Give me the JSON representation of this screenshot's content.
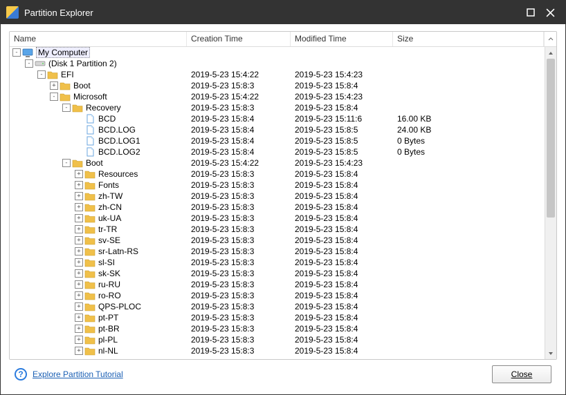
{
  "window": {
    "title": "Partition Explorer"
  },
  "columns": {
    "name": "Name",
    "creation": "Creation Time",
    "modified": "Modified Time",
    "size": "Size"
  },
  "footer": {
    "tutorial": "Explore Partition Tutorial",
    "close": "Close"
  },
  "tree": [
    {
      "depth": 0,
      "exp": "-",
      "icon": "computer",
      "name": "My Computer",
      "ct": "",
      "mt": "",
      "sz": "",
      "hl": true
    },
    {
      "depth": 1,
      "exp": "-",
      "icon": "disk",
      "name": "(Disk 1 Partition 2)",
      "ct": "",
      "mt": "",
      "sz": ""
    },
    {
      "depth": 2,
      "exp": "-",
      "icon": "folder",
      "name": "EFI",
      "ct": "2019-5-23 15:4:22",
      "mt": "2019-5-23 15:4:23",
      "sz": ""
    },
    {
      "depth": 3,
      "exp": "+",
      "icon": "folder",
      "name": "Boot",
      "ct": "2019-5-23 15:8:3",
      "mt": "2019-5-23 15:8:4",
      "sz": ""
    },
    {
      "depth": 3,
      "exp": "-",
      "icon": "folder",
      "name": "Microsoft",
      "ct": "2019-5-23 15:4:22",
      "mt": "2019-5-23 15:4:23",
      "sz": ""
    },
    {
      "depth": 4,
      "exp": "-",
      "icon": "folder",
      "name": "Recovery",
      "ct": "2019-5-23 15:8:3",
      "mt": "2019-5-23 15:8:4",
      "sz": ""
    },
    {
      "depth": 5,
      "exp": "",
      "icon": "file",
      "name": "BCD",
      "ct": "2019-5-23 15:8:4",
      "mt": "2019-5-23 15:11:6",
      "sz": "16.00 KB"
    },
    {
      "depth": 5,
      "exp": "",
      "icon": "file",
      "name": "BCD.LOG",
      "ct": "2019-5-23 15:8:4",
      "mt": "2019-5-23 15:8:5",
      "sz": "24.00 KB"
    },
    {
      "depth": 5,
      "exp": "",
      "icon": "file",
      "name": "BCD.LOG1",
      "ct": "2019-5-23 15:8:4",
      "mt": "2019-5-23 15:8:5",
      "sz": "0 Bytes"
    },
    {
      "depth": 5,
      "exp": "",
      "icon": "file",
      "name": "BCD.LOG2",
      "ct": "2019-5-23 15:8:4",
      "mt": "2019-5-23 15:8:5",
      "sz": "0 Bytes"
    },
    {
      "depth": 4,
      "exp": "-",
      "icon": "folder",
      "name": "Boot",
      "ct": "2019-5-23 15:4:22",
      "mt": "2019-5-23 15:4:23",
      "sz": ""
    },
    {
      "depth": 5,
      "exp": "+",
      "icon": "folder",
      "name": "Resources",
      "ct": "2019-5-23 15:8:3",
      "mt": "2019-5-23 15:8:4",
      "sz": ""
    },
    {
      "depth": 5,
      "exp": "+",
      "icon": "folder",
      "name": "Fonts",
      "ct": "2019-5-23 15:8:3",
      "mt": "2019-5-23 15:8:4",
      "sz": ""
    },
    {
      "depth": 5,
      "exp": "+",
      "icon": "folder",
      "name": "zh-TW",
      "ct": "2019-5-23 15:8:3",
      "mt": "2019-5-23 15:8:4",
      "sz": ""
    },
    {
      "depth": 5,
      "exp": "+",
      "icon": "folder",
      "name": "zh-CN",
      "ct": "2019-5-23 15:8:3",
      "mt": "2019-5-23 15:8:4",
      "sz": ""
    },
    {
      "depth": 5,
      "exp": "+",
      "icon": "folder",
      "name": "uk-UA",
      "ct": "2019-5-23 15:8:3",
      "mt": "2019-5-23 15:8:4",
      "sz": ""
    },
    {
      "depth": 5,
      "exp": "+",
      "icon": "folder",
      "name": "tr-TR",
      "ct": "2019-5-23 15:8:3",
      "mt": "2019-5-23 15:8:4",
      "sz": ""
    },
    {
      "depth": 5,
      "exp": "+",
      "icon": "folder",
      "name": "sv-SE",
      "ct": "2019-5-23 15:8:3",
      "mt": "2019-5-23 15:8:4",
      "sz": ""
    },
    {
      "depth": 5,
      "exp": "+",
      "icon": "folder",
      "name": "sr-Latn-RS",
      "ct": "2019-5-23 15:8:3",
      "mt": "2019-5-23 15:8:4",
      "sz": ""
    },
    {
      "depth": 5,
      "exp": "+",
      "icon": "folder",
      "name": "sl-SI",
      "ct": "2019-5-23 15:8:3",
      "mt": "2019-5-23 15:8:4",
      "sz": ""
    },
    {
      "depth": 5,
      "exp": "+",
      "icon": "folder",
      "name": "sk-SK",
      "ct": "2019-5-23 15:8:3",
      "mt": "2019-5-23 15:8:4",
      "sz": ""
    },
    {
      "depth": 5,
      "exp": "+",
      "icon": "folder",
      "name": "ru-RU",
      "ct": "2019-5-23 15:8:3",
      "mt": "2019-5-23 15:8:4",
      "sz": ""
    },
    {
      "depth": 5,
      "exp": "+",
      "icon": "folder",
      "name": "ro-RO",
      "ct": "2019-5-23 15:8:3",
      "mt": "2019-5-23 15:8:4",
      "sz": ""
    },
    {
      "depth": 5,
      "exp": "+",
      "icon": "folder",
      "name": "QPS-PLOC",
      "ct": "2019-5-23 15:8:3",
      "mt": "2019-5-23 15:8:4",
      "sz": ""
    },
    {
      "depth": 5,
      "exp": "+",
      "icon": "folder",
      "name": "pt-PT",
      "ct": "2019-5-23 15:8:3",
      "mt": "2019-5-23 15:8:4",
      "sz": ""
    },
    {
      "depth": 5,
      "exp": "+",
      "icon": "folder",
      "name": "pt-BR",
      "ct": "2019-5-23 15:8:3",
      "mt": "2019-5-23 15:8:4",
      "sz": ""
    },
    {
      "depth": 5,
      "exp": "+",
      "icon": "folder",
      "name": "pl-PL",
      "ct": "2019-5-23 15:8:3",
      "mt": "2019-5-23 15:8:4",
      "sz": ""
    },
    {
      "depth": 5,
      "exp": "+",
      "icon": "folder",
      "name": "nl-NL",
      "ct": "2019-5-23 15:8:3",
      "mt": "2019-5-23 15:8:4",
      "sz": ""
    }
  ]
}
